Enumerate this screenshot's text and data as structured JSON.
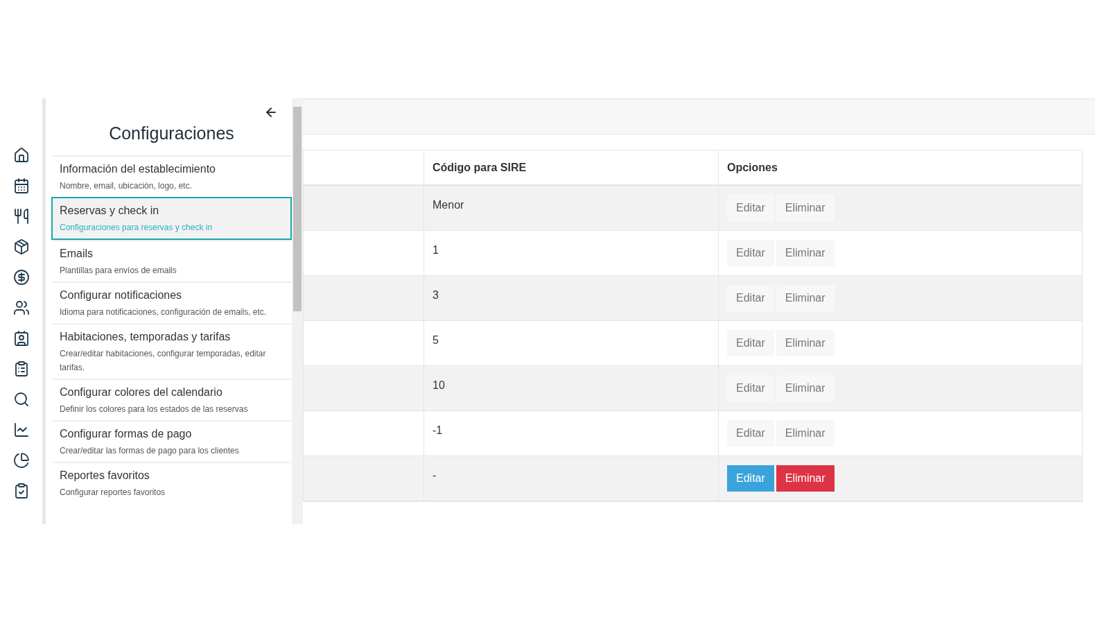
{
  "settings_panel": {
    "title": "Configuraciones",
    "items": [
      {
        "label": "Información del establecimiento",
        "description": "Nombre, email, ubicación, logo, etc.",
        "selected": false
      },
      {
        "label": "Reservas y check in",
        "description": "Configuraciones para reservas y check in",
        "selected": true
      },
      {
        "label": "Emails",
        "description": "Plantillas para envíos de emails",
        "selected": false
      },
      {
        "label": "Configurar notificaciones",
        "description": "Idioma para notificaciones, configuración de emails, etc.",
        "selected": false
      },
      {
        "label": "Habitaciones, temporadas y tarifas",
        "description": "Crear/editar habitaciones, configurar temporadas, editar tarifas.",
        "selected": false
      },
      {
        "label": "Configurar colores del calendario",
        "description": "Definir los colores para los estados de las reservas",
        "selected": false
      },
      {
        "label": "Configurar formas de pago",
        "description": "Crear/editar las formas de pago para los clientes",
        "selected": false
      },
      {
        "label": "Reportes favoritos",
        "description": "Configurar reportes favoritos",
        "selected": false
      }
    ]
  },
  "table": {
    "columns": [
      "Código para SIRE",
      "Opciones"
    ],
    "rows": [
      {
        "code": "Menor",
        "edit": "Editar",
        "delete": "Eliminar",
        "highlighted": false
      },
      {
        "code": "1",
        "edit": "Editar",
        "delete": "Eliminar",
        "highlighted": false
      },
      {
        "code": "3",
        "edit": "Editar",
        "delete": "Eliminar",
        "highlighted": false
      },
      {
        "code": "5",
        "edit": "Editar",
        "delete": "Eliminar",
        "highlighted": false
      },
      {
        "code": "10",
        "edit": "Editar",
        "delete": "Eliminar",
        "highlighted": false
      },
      {
        "code": "-1",
        "edit": "Editar",
        "delete": "Eliminar",
        "highlighted": false
      },
      {
        "code": "-",
        "edit": "Editar",
        "delete": "Eliminar",
        "highlighted": true
      }
    ]
  }
}
